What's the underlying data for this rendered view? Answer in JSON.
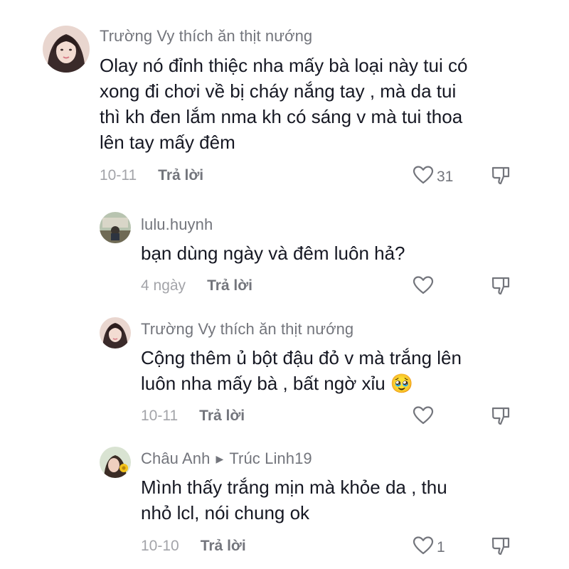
{
  "comments": [
    {
      "username": "Trường Vy thích ăn thịt nướng",
      "text_lines": [
        "Olay nó đỉnh thiệc nha mấy bà loại này tui có",
        "xong đi chơi về bị cháy nắng tay , mà da tui",
        "thì kh đen lắm nma kh có sáng v mà tui thoa",
        "lên tay mấy đêm"
      ],
      "date": "10-11",
      "reply_label": "Trả lời",
      "like_count": "31"
    },
    {
      "username": "lulu.huynh",
      "text_lines": [
        "bạn dùng ngày và đêm luôn hả?"
      ],
      "date": "4 ngày",
      "reply_label": "Trả lời",
      "like_count": ""
    },
    {
      "username": "Trường Vy thích ăn thịt nướng",
      "text_lines": [
        "Cộng thêm ủ bột đậu đỏ v mà trắng lên",
        "luôn nha mấy bà , bất ngờ xỉu 🥹"
      ],
      "date": "10-11",
      "reply_label": "Trả lời",
      "like_count": ""
    },
    {
      "username": "Châu Anh",
      "reply_to": "Trúc Linh19",
      "text_lines": [
        "Mình thấy trắng mịn mà khỏe da , thu",
        "nhỏ lcl, nói chung ok"
      ],
      "date": "10-10",
      "reply_label": "Trả lời",
      "like_count": "1"
    }
  ],
  "icons": {
    "like": "heart-outline-icon",
    "dislike": "thumbs-down-icon",
    "reply_arrow": "triangle-right-icon"
  },
  "colors": {
    "primary_text": "#161823",
    "secondary_text": "#73757c",
    "tertiary_text": "#a3a4a9"
  }
}
